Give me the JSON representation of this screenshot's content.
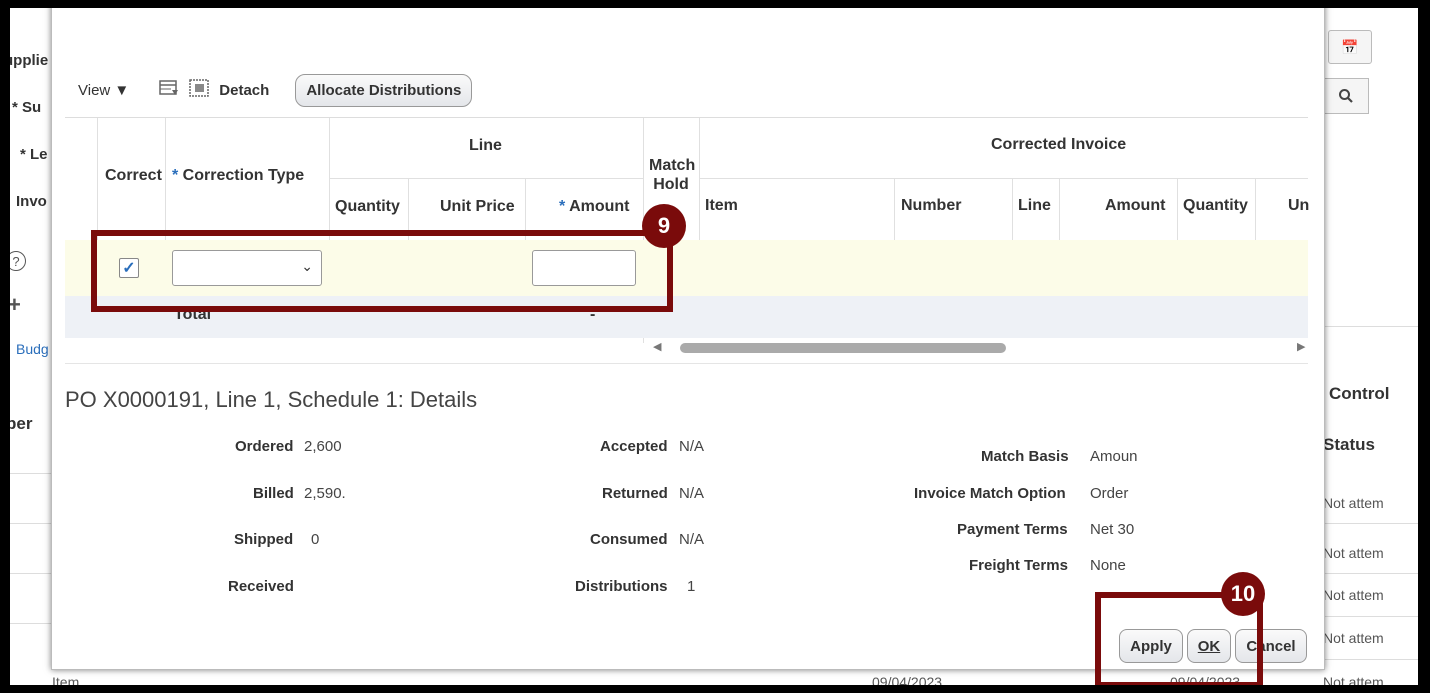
{
  "background": {
    "left_labels": [
      "upplie",
      "* Su",
      "* Le",
      "Invo"
    ],
    "bber": "ber",
    "budg": "Budg",
    "control": "Control",
    "status": "Status",
    "status_rows": [
      "Not attem",
      "Not attem",
      "Not attem",
      "Not attem",
      "Not attem"
    ],
    "bottom_item": "Item",
    "bottom_date1": "09/04/2023",
    "bottom_date2": "09/04/2023"
  },
  "toolbar": {
    "view_label": "View",
    "detach_label": "Detach",
    "allocate_label": "Allocate Distributions"
  },
  "table": {
    "headers": {
      "correct": "Correct",
      "correction_type": "Correction Type",
      "line_group": "Line",
      "quantity": "Quantity",
      "unit_price": "Unit Price",
      "amount": "Amount",
      "match_hold": "Match Hold",
      "corrected_invoice_group": "Corrected Invoice",
      "item": "Item",
      "number": "Number",
      "line": "Line",
      "ci_amount": "Amount",
      "ci_quantity": "Quantity",
      "ci_unit": "Un"
    },
    "row": {
      "correct_checked": true,
      "correction_type_value": "",
      "amount_value": ""
    },
    "total": {
      "label": "Total",
      "amount": "-"
    }
  },
  "details": {
    "title": "PO X0000191, Line 1, Schedule 1: Details",
    "col1": [
      {
        "label": "Ordered",
        "value": "2,600"
      },
      {
        "label": "Billed",
        "value": "2,590."
      },
      {
        "label": "Shipped",
        "value": "0"
      },
      {
        "label": "Received",
        "value": ""
      }
    ],
    "col2": [
      {
        "label": "Accepted",
        "value": "N/A"
      },
      {
        "label": "Returned",
        "value": "N/A"
      },
      {
        "label": "Consumed",
        "value": "N/A"
      },
      {
        "label": "Distributions",
        "value": "1"
      }
    ],
    "col3": [
      {
        "label": "Match Basis",
        "value": "Amoun"
      },
      {
        "label": "Invoice Match Option",
        "value": "Order"
      },
      {
        "label": "Payment Terms",
        "value": "Net 30"
      },
      {
        "label": "Freight Terms",
        "value": "None"
      }
    ]
  },
  "footer": {
    "apply": "Apply",
    "ok": "OK",
    "cancel": "Cancel"
  },
  "callouts": {
    "step9": "9",
    "step10": "10",
    "color": "#7a0b0b"
  }
}
